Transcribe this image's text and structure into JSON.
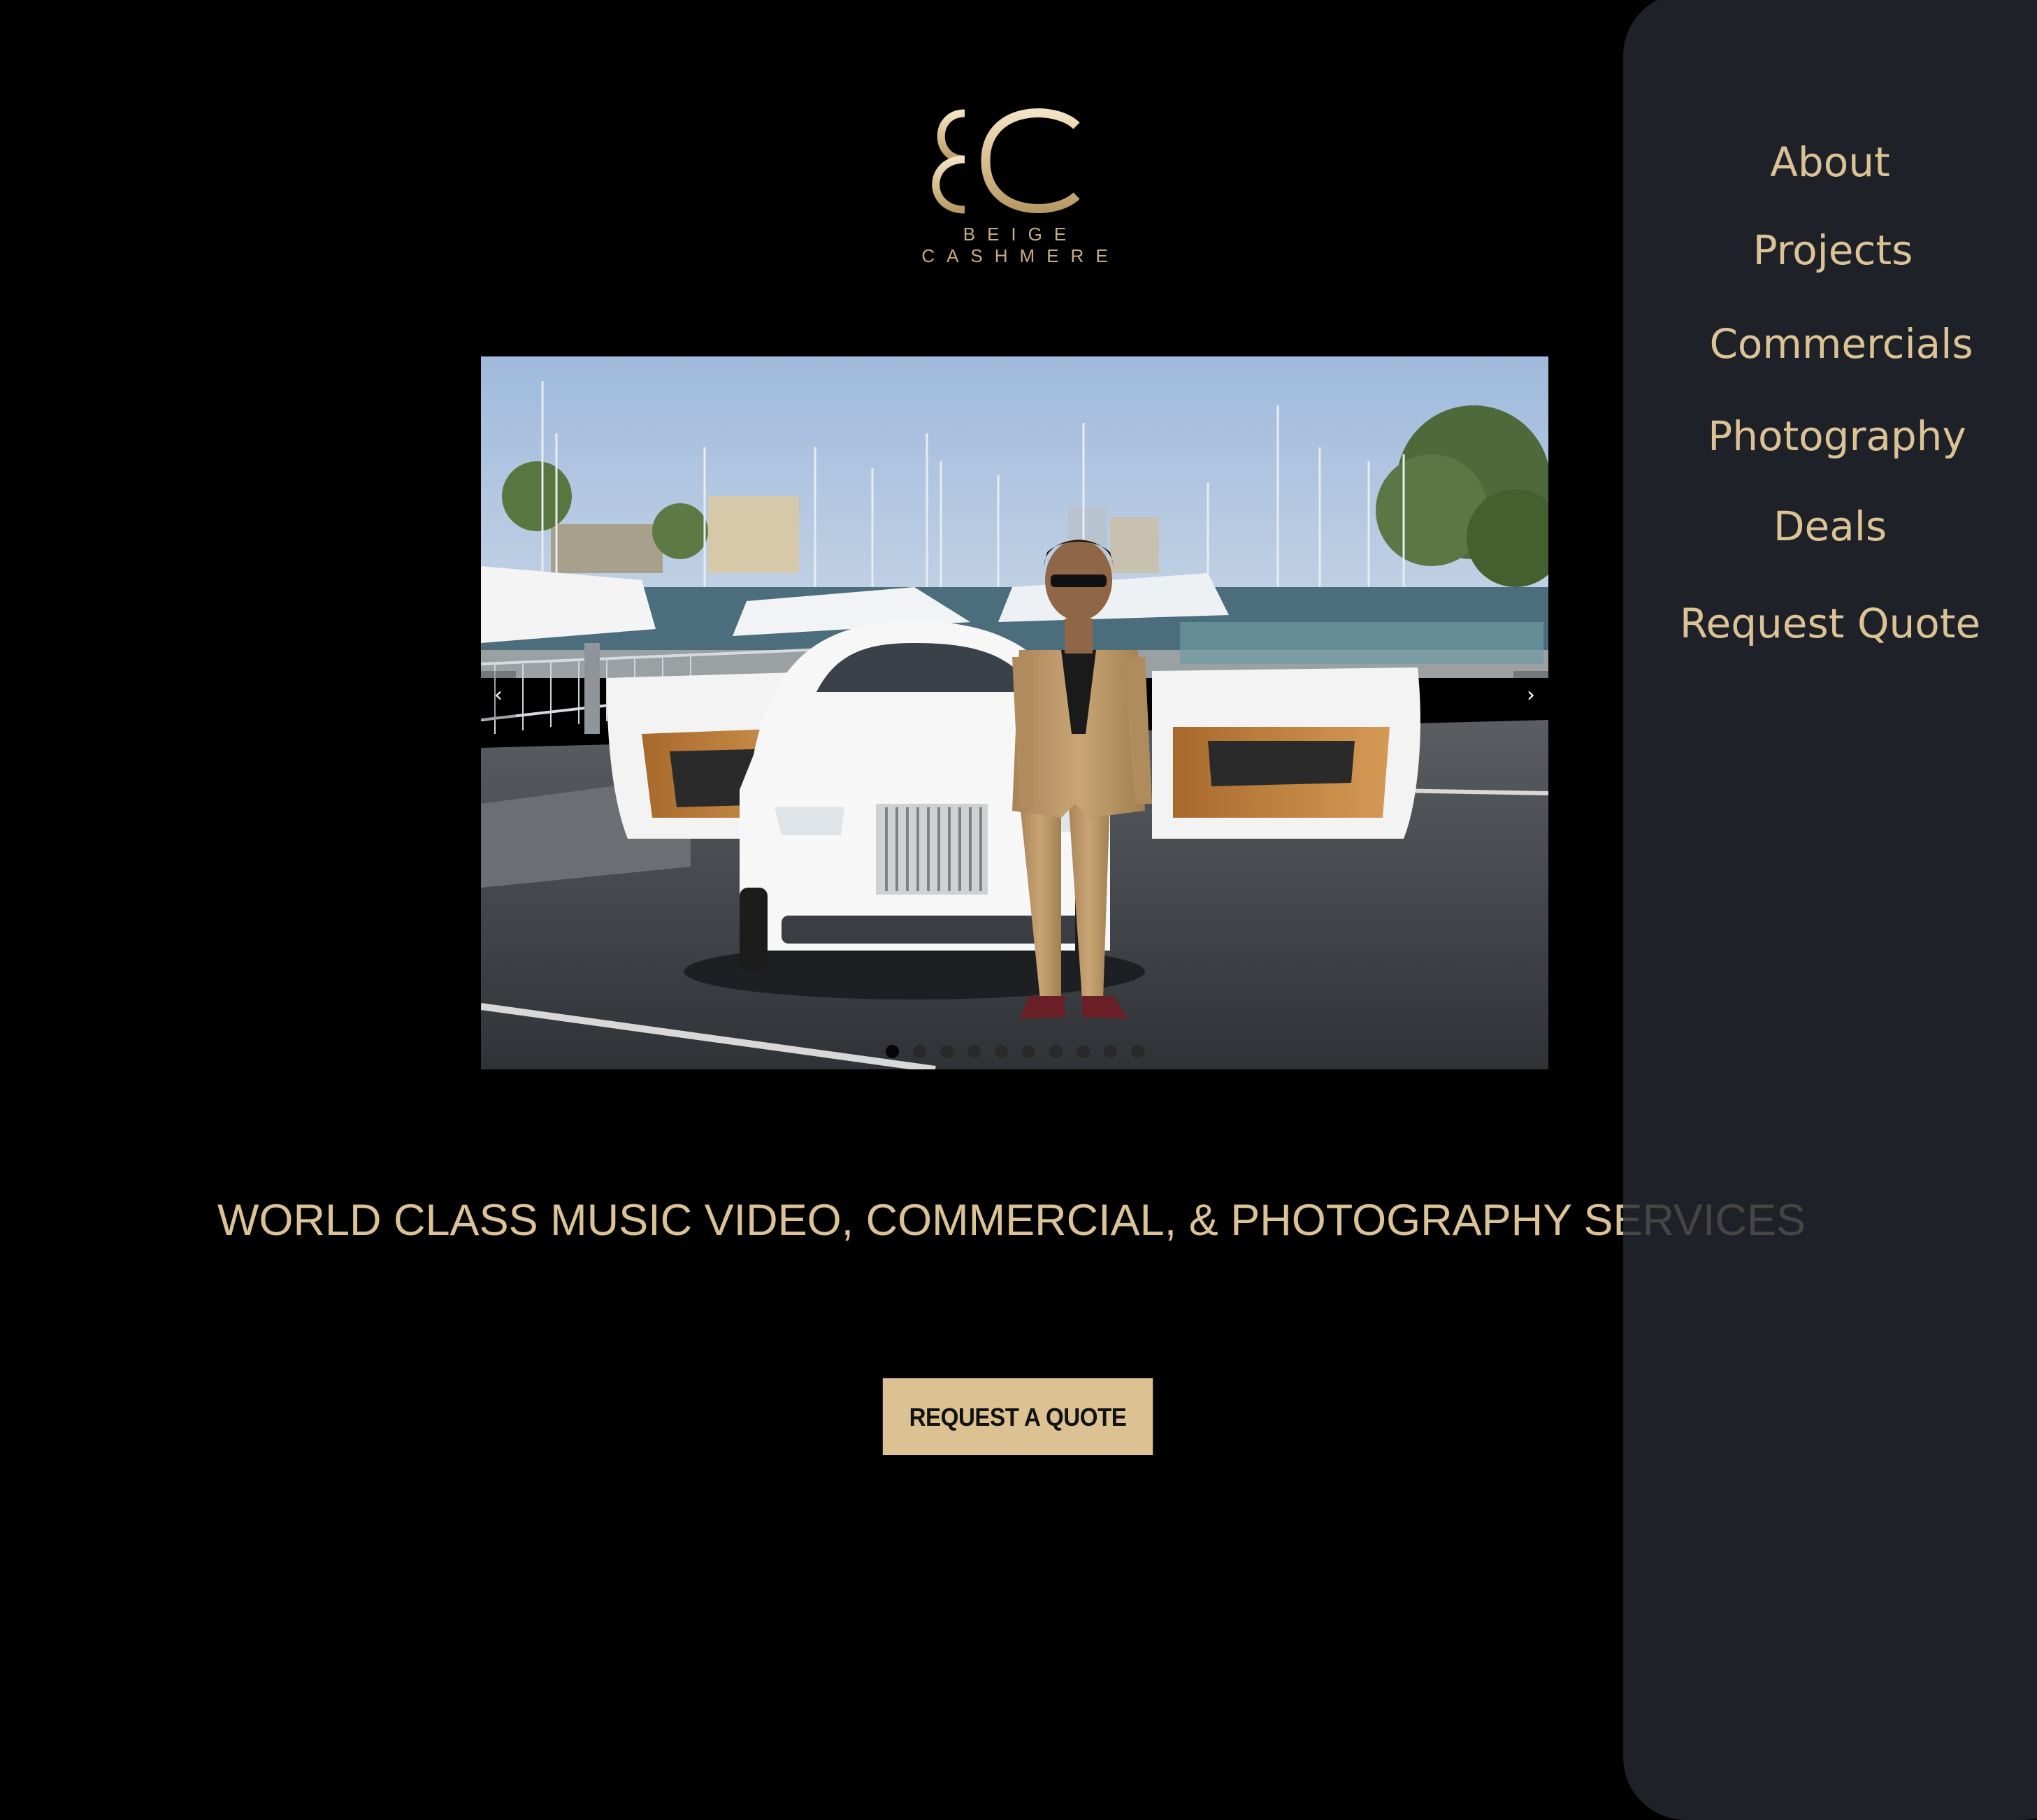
{
  "brand": {
    "monogram": "BC",
    "name": "BEIGE CASHMERE",
    "gold": "#dcc396"
  },
  "slider": {
    "prev_icon": "chevron-left-icon",
    "next_icon": "chevron-right-icon",
    "prev_glyph": "‹",
    "next_glyph": "›",
    "slide_count": 10,
    "active_slide": 1
  },
  "hero": {
    "headline": "WORLD CLASS MUSIC VIDEO, COMMERCIAL, & PHOTOGRAPHY SERVICES",
    "cta_label": "REQUEST A QUOTE",
    "cta_color": "#dcc193"
  },
  "nav": {
    "panel_color": "#242a31",
    "items": [
      {
        "label": "About"
      },
      {
        "label": "Projects"
      },
      {
        "label": "Commercials"
      },
      {
        "label": "Photography"
      },
      {
        "label": "Deals"
      },
      {
        "label": "Request Quote"
      }
    ]
  }
}
